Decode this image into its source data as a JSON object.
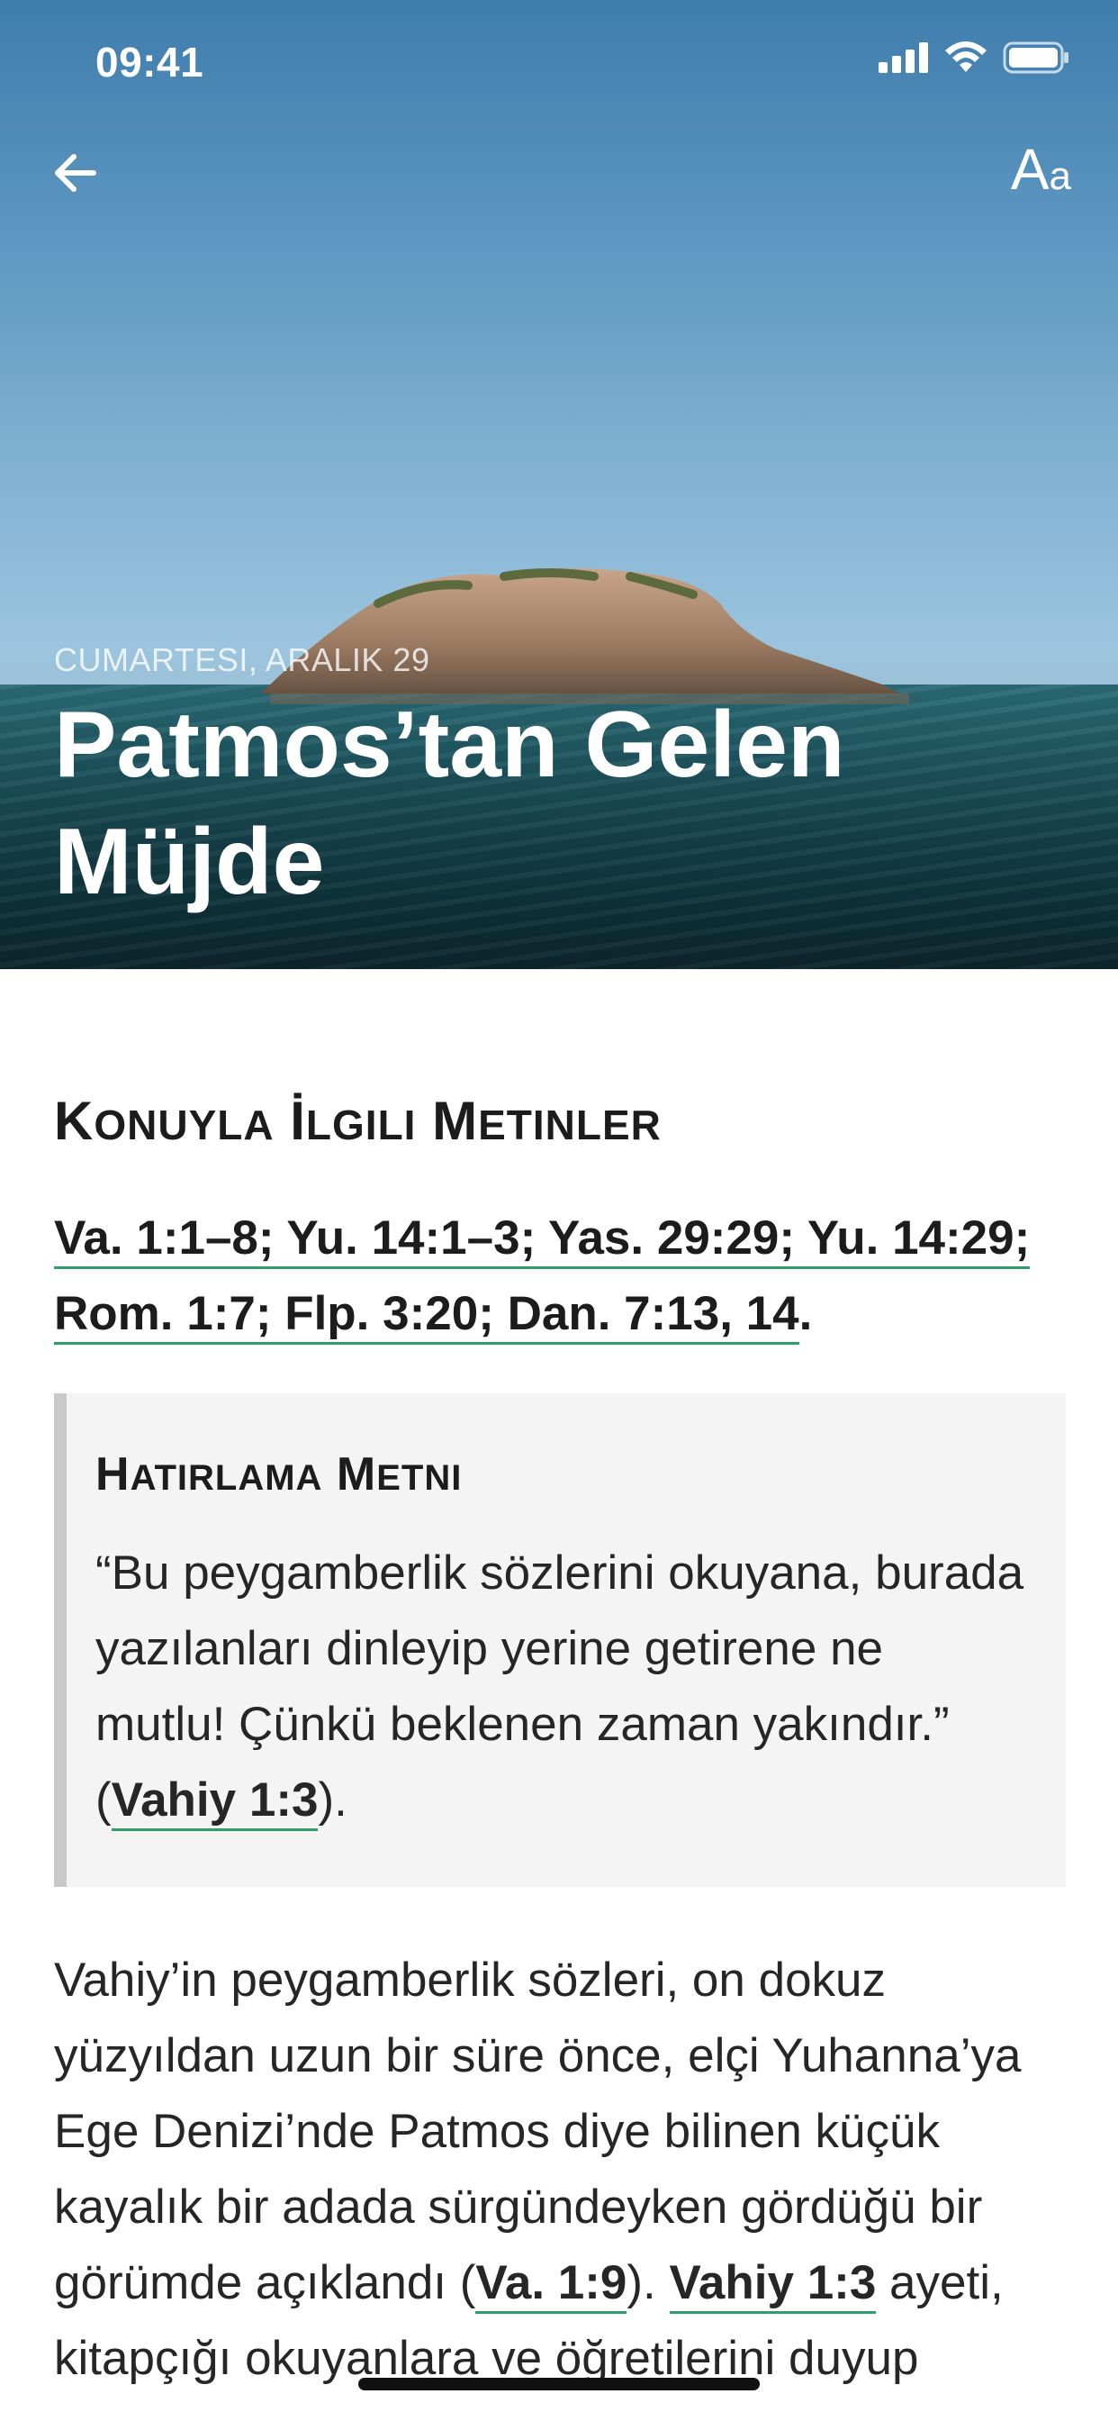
{
  "status_bar": {
    "time": "09:41"
  },
  "hero": {
    "date": "CUMARTESI, ARALIK 29",
    "title_line1": "Patmos’tan Gelen",
    "title_line2": "Müjde"
  },
  "nav": {
    "back_icon": "arrow-left-icon",
    "font_size_label_big": "A",
    "font_size_label_small": "a"
  },
  "related_texts": {
    "heading_first": "K",
    "heading_rest1": "ONUYLA",
    "heading_word2_first": "İ",
    "heading_rest2": "LGILI",
    "heading_word3_first": "M",
    "heading_rest3": "ETINLER",
    "line1_refs": [
      "Va. 1:1–8; Yu. 14:1–3; Yas. 29:29; Yu. 14:29;"
    ],
    "line2_refs": "Rom. 1:7; Flp. 3:20; Dan. 7:13, 14",
    "line2_end": "."
  },
  "memory_verse": {
    "heading_first": "H",
    "heading_rest1": "ATIRLAMA",
    "heading_word2_first": "M",
    "heading_rest2": "ETNI",
    "text": "“Bu peygamberlik sözlerini okuyana, burada yazılanları dinleyip yerine getirene ne mutlu! Çünkü beklenen zaman yakındır.” (",
    "reference": "Vahiy 1:3",
    "text_end": ")."
  },
  "body": {
    "p1_start": "Vahiy’in peygamberlik sözleri, on dokuz yüzyıldan uzun bir süre önce, elçi Yuhanna’ya Ege Denizi’nde Patmos diye bilinen küçük kayalık bir adada sürgündeyken gördüğü bir görümde açıklandı (",
    "p1_ref1": "Va. 1:9",
    "p1_mid": "). ",
    "p1_ref2": "Vahiy 1:3",
    "p1_end": " ayeti, kitapçığı okuyanlara ve öğretilerini duyup"
  },
  "colors": {
    "link_underline": "#2f9e6a",
    "memory_bg": "#f4f4f4",
    "memory_bar": "#c9c9c9"
  }
}
